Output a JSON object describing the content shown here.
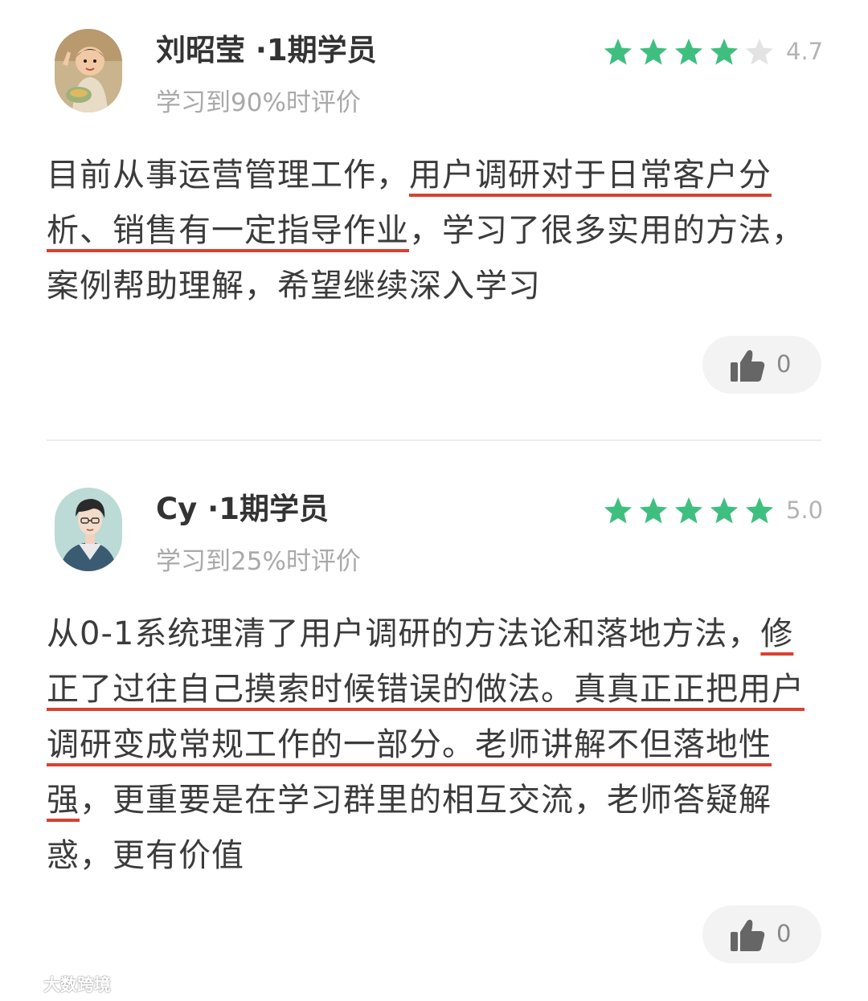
{
  "reviews": [
    {
      "author": "刘昭莹 ·1期学员",
      "progress": "学习到90%时评价",
      "rating": 4.7,
      "rating_text": "4.7",
      "stars_filled": 4,
      "body": {
        "before": "目前从事运营管理工作，",
        "highlight": "用户调研对于日常客户分析、销售有一定指导作业",
        "after": "，学习了很多实用的方法，案例帮助理解，希望继续深入学习"
      },
      "likes": "0"
    },
    {
      "author": "Cy ·1期学员",
      "progress": "学习到25%时评价",
      "rating": 5.0,
      "rating_text": "5.0",
      "stars_filled": 5,
      "body": {
        "before": "从0-1系统理清了用户调研的方法论和落地方法，",
        "highlight": "修正了过往自己摸索时候错误的做法。真真正正把用户调研变成常规工作的一部分。老师讲解不但落地性强",
        "after": "，更重要是在学习群里的相互交流，老师答疑解惑，更有价值"
      },
      "likes": "0"
    }
  ],
  "colors": {
    "star_filled": "#3fbf7f",
    "star_empty": "#e3e3e3",
    "underline": "#d9412f",
    "like_bg": "#f3f3f3"
  },
  "icons": {
    "star": "star-icon",
    "like": "thumbs-up-icon"
  },
  "watermark": {
    "text": "大数跨境"
  }
}
